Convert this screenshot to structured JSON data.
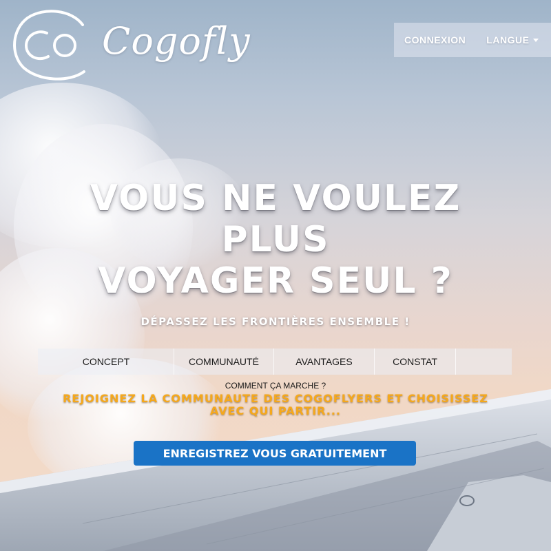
{
  "brand": {
    "name": "Cogofly"
  },
  "topnav": {
    "login": "CONNEXION",
    "language": "LANGUE"
  },
  "hero": {
    "title_lines": [
      "VOUS NE VOULEZ",
      "PLUS",
      "VOYAGER SEUL ?"
    ],
    "subtitle": "DÉPASSEZ LES FRONTIÈRES ENSEMBLE !"
  },
  "tabs": [
    {
      "label": "CONCEPT"
    },
    {
      "label": "COMMUNAUTÉ"
    },
    {
      "label": "AVANTAGES"
    },
    {
      "label": "CONSTAT"
    }
  ],
  "how_it_works": "COMMENT ÇA MARCHE ?",
  "join_lines": [
    "REJOIGNEZ LA COMMUNAUTE DES COGOFLYERS ET CHOISISSEZ",
    "AVEC QUI PARTIR..."
  ],
  "cta": {
    "label": "ENREGISTREZ VOUS GRATUITEMENT"
  },
  "colors": {
    "accent_blue": "#1a73c6",
    "accent_orange": "#f5a81c",
    "text_white": "#ffffff"
  }
}
